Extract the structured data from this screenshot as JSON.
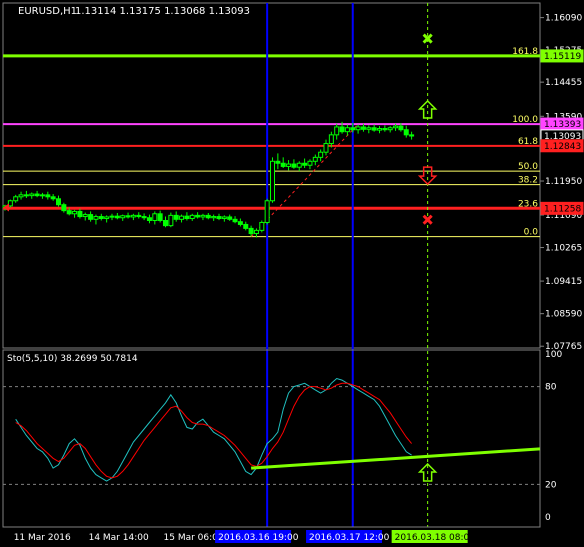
{
  "header": {
    "symbol": "EURUSD,H1",
    "ohlc": "1.13114 1.13175 1.13068 1.13093"
  },
  "colors": {
    "background": "#000000",
    "grid": "#808080",
    "bull_candle": "#00ff00",
    "fib_line": "#ffff66",
    "fib_161": "#7fff00",
    "fib_100": "#ff44ff",
    "support_red": "#ff2020",
    "vertical_blue": "#0000ff",
    "stoch_main": "#20c0c0",
    "stoch_signal": "#ff0000",
    "trendline": "#7fff00",
    "dashed_future": "#7fff00",
    "price_label_current": "#ffffff"
  },
  "chart_data": [
    {
      "type": "candlestick",
      "title": "EURUSD,H1",
      "ylim": [
        1.0772,
        1.1646
      ],
      "y_ticks": [
        "1.16090",
        "1.15275",
        "1.14455",
        "1.13590",
        "1.12765",
        "1.11950",
        "1.11090",
        "1.10265",
        "1.09415",
        "1.08590",
        "1.07765"
      ],
      "price_tags": [
        {
          "label": "1.15119",
          "value": 1.15119,
          "color": "#7fff00",
          "text_color": "#000000"
        },
        {
          "label": "1.13393",
          "value": 1.13393,
          "color": "#ff44ff",
          "text_color": "#000000"
        },
        {
          "label": "1.13093",
          "value": 1.13093,
          "color": "#ffffff",
          "text_color": "#000000",
          "boxed": true
        },
        {
          "label": "1.12843",
          "value": 1.12843,
          "color": "#ff2020",
          "text_color": "#000000"
        },
        {
          "label": "1.11258",
          "value": 1.11258,
          "color": "#ff2020",
          "text_color": "#000000"
        }
      ],
      "fibonacci_levels": [
        {
          "label": "161.8",
          "value": 1.1512
        },
        {
          "label": "100.0",
          "value": 1.1339
        },
        {
          "label": "61.8",
          "value": 1.1284
        },
        {
          "label": "50.0",
          "value": 1.122
        },
        {
          "label": "38.2",
          "value": 1.1186
        },
        {
          "label": "23.6",
          "value": 1.1126
        },
        {
          "label": "0.0",
          "value": 1.1054
        }
      ],
      "horizontal_lines": [
        {
          "value": 1.1512,
          "color": "#7fff00",
          "width": 3
        },
        {
          "value": 1.1339,
          "color": "#ff44ff",
          "width": 2
        },
        {
          "value": 1.1284,
          "color": "#ff2020",
          "width": 2
        },
        {
          "value": 1.1126,
          "color": "#ff2020",
          "width": 3
        }
      ],
      "candles": [
        {
          "t": 0,
          "o": 1.1128,
          "h": 1.1135,
          "l": 1.112,
          "c": 1.1132
        },
        {
          "t": 1,
          "o": 1.1132,
          "h": 1.1148,
          "l": 1.1128,
          "c": 1.1145
        },
        {
          "t": 2,
          "o": 1.1145,
          "h": 1.116,
          "l": 1.114,
          "c": 1.1155
        },
        {
          "t": 3,
          "o": 1.1155,
          "h": 1.1168,
          "l": 1.1148,
          "c": 1.116
        },
        {
          "t": 4,
          "o": 1.116,
          "h": 1.117,
          "l": 1.1152,
          "c": 1.1158
        },
        {
          "t": 5,
          "o": 1.1158,
          "h": 1.1166,
          "l": 1.115,
          "c": 1.1162
        },
        {
          "t": 6,
          "o": 1.1162,
          "h": 1.117,
          "l": 1.1154,
          "c": 1.1158
        },
        {
          "t": 7,
          "o": 1.1158,
          "h": 1.1165,
          "l": 1.115,
          "c": 1.116
        },
        {
          "t": 8,
          "o": 1.116,
          "h": 1.1168,
          "l": 1.1148,
          "c": 1.1155
        },
        {
          "t": 9,
          "o": 1.1155,
          "h": 1.1162,
          "l": 1.1145,
          "c": 1.115
        },
        {
          "t": 10,
          "o": 1.115,
          "h": 1.1158,
          "l": 1.113,
          "c": 1.1135
        },
        {
          "t": 11,
          "o": 1.1135,
          "h": 1.114,
          "l": 1.1115,
          "c": 1.112
        },
        {
          "t": 12,
          "o": 1.112,
          "h": 1.1128,
          "l": 1.1108,
          "c": 1.1112
        },
        {
          "t": 13,
          "o": 1.1112,
          "h": 1.1122,
          "l": 1.1102,
          "c": 1.1118
        },
        {
          "t": 14,
          "o": 1.1118,
          "h": 1.1125,
          "l": 1.11,
          "c": 1.1105
        },
        {
          "t": 15,
          "o": 1.1105,
          "h": 1.1115,
          "l": 1.1095,
          "c": 1.111
        },
        {
          "t": 16,
          "o": 1.111,
          "h": 1.1118,
          "l": 1.1092,
          "c": 1.1098
        },
        {
          "t": 17,
          "o": 1.1098,
          "h": 1.111,
          "l": 1.1085,
          "c": 1.1105
        },
        {
          "t": 18,
          "o": 1.1105,
          "h": 1.1112,
          "l": 1.1095,
          "c": 1.11
        },
        {
          "t": 19,
          "o": 1.11,
          "h": 1.1108,
          "l": 1.109,
          "c": 1.1104
        },
        {
          "t": 20,
          "o": 1.1104,
          "h": 1.1112,
          "l": 1.1096,
          "c": 1.1106
        },
        {
          "t": 21,
          "o": 1.1106,
          "h": 1.1114,
          "l": 1.1098,
          "c": 1.1102
        },
        {
          "t": 22,
          "o": 1.1102,
          "h": 1.111,
          "l": 1.1094,
          "c": 1.1107
        },
        {
          "t": 23,
          "o": 1.1107,
          "h": 1.1115,
          "l": 1.11,
          "c": 1.1104
        },
        {
          "t": 24,
          "o": 1.1104,
          "h": 1.1112,
          "l": 1.1096,
          "c": 1.1108
        },
        {
          "t": 25,
          "o": 1.1108,
          "h": 1.1116,
          "l": 1.11,
          "c": 1.1105
        },
        {
          "t": 26,
          "o": 1.1105,
          "h": 1.1113,
          "l": 1.1096,
          "c": 1.1102
        },
        {
          "t": 27,
          "o": 1.1102,
          "h": 1.111,
          "l": 1.1088,
          "c": 1.1095
        },
        {
          "t": 28,
          "o": 1.1095,
          "h": 1.1118,
          "l": 1.1085,
          "c": 1.1112
        },
        {
          "t": 29,
          "o": 1.1112,
          "h": 1.112,
          "l": 1.109,
          "c": 1.1095
        },
        {
          "t": 30,
          "o": 1.1095,
          "h": 1.1105,
          "l": 1.1078,
          "c": 1.1082
        },
        {
          "t": 31,
          "o": 1.1082,
          "h": 1.1115,
          "l": 1.1078,
          "c": 1.1108
        },
        {
          "t": 32,
          "o": 1.1108,
          "h": 1.1118,
          "l": 1.1092,
          "c": 1.1098
        },
        {
          "t": 33,
          "o": 1.1098,
          "h": 1.111,
          "l": 1.109,
          "c": 1.1106
        },
        {
          "t": 34,
          "o": 1.1106,
          "h": 1.1116,
          "l": 1.1095,
          "c": 1.11
        },
        {
          "t": 35,
          "o": 1.11,
          "h": 1.1112,
          "l": 1.1094,
          "c": 1.1108
        },
        {
          "t": 36,
          "o": 1.1108,
          "h": 1.1116,
          "l": 1.11,
          "c": 1.1104
        },
        {
          "t": 37,
          "o": 1.1104,
          "h": 1.1112,
          "l": 1.1096,
          "c": 1.1108
        },
        {
          "t": 38,
          "o": 1.1108,
          "h": 1.1114,
          "l": 1.1098,
          "c": 1.1102
        },
        {
          "t": 39,
          "o": 1.1102,
          "h": 1.111,
          "l": 1.1094,
          "c": 1.1105
        },
        {
          "t": 40,
          "o": 1.1105,
          "h": 1.1112,
          "l": 1.1096,
          "c": 1.11
        },
        {
          "t": 41,
          "o": 1.11,
          "h": 1.1108,
          "l": 1.1092,
          "c": 1.1104
        },
        {
          "t": 42,
          "o": 1.1104,
          "h": 1.111,
          "l": 1.1094,
          "c": 1.1098
        },
        {
          "t": 43,
          "o": 1.1098,
          "h": 1.1106,
          "l": 1.1088,
          "c": 1.1092
        },
        {
          "t": 44,
          "o": 1.1092,
          "h": 1.11,
          "l": 1.108,
          "c": 1.1085
        },
        {
          "t": 45,
          "o": 1.1085,
          "h": 1.1092,
          "l": 1.107,
          "c": 1.1075
        },
        {
          "t": 46,
          "o": 1.1075,
          "h": 1.1082,
          "l": 1.1055,
          "c": 1.1062
        },
        {
          "t": 47,
          "o": 1.1062,
          "h": 1.1075,
          "l": 1.1052,
          "c": 1.107
        },
        {
          "t": 48,
          "o": 1.107,
          "h": 1.1095,
          "l": 1.1065,
          "c": 1.109
        },
        {
          "t": 49,
          "o": 1.109,
          "h": 1.115,
          "l": 1.1085,
          "c": 1.1145
        },
        {
          "t": 50,
          "o": 1.1145,
          "h": 1.1255,
          "l": 1.114,
          "c": 1.1245
        },
        {
          "t": 51,
          "o": 1.1245,
          "h": 1.1265,
          "l": 1.1225,
          "c": 1.124
        },
        {
          "t": 52,
          "o": 1.124,
          "h": 1.1255,
          "l": 1.1228,
          "c": 1.1232
        },
        {
          "t": 53,
          "o": 1.1232,
          "h": 1.1248,
          "l": 1.1222,
          "c": 1.1238
        },
        {
          "t": 54,
          "o": 1.1238,
          "h": 1.125,
          "l": 1.1226,
          "c": 1.123
        },
        {
          "t": 55,
          "o": 1.123,
          "h": 1.1245,
          "l": 1.122,
          "c": 1.124
        },
        {
          "t": 56,
          "o": 1.124,
          "h": 1.1252,
          "l": 1.1228,
          "c": 1.1235
        },
        {
          "t": 57,
          "o": 1.1235,
          "h": 1.125,
          "l": 1.1225,
          "c": 1.1245
        },
        {
          "t": 58,
          "o": 1.1245,
          "h": 1.1262,
          "l": 1.1235,
          "c": 1.1255
        },
        {
          "t": 59,
          "o": 1.1255,
          "h": 1.1275,
          "l": 1.1245,
          "c": 1.1268
        },
        {
          "t": 60,
          "o": 1.1268,
          "h": 1.13,
          "l": 1.126,
          "c": 1.129
        },
        {
          "t": 61,
          "o": 1.129,
          "h": 1.132,
          "l": 1.128,
          "c": 1.1312
        },
        {
          "t": 62,
          "o": 1.1312,
          "h": 1.134,
          "l": 1.13,
          "c": 1.1332
        },
        {
          "t": 63,
          "o": 1.1332,
          "h": 1.1345,
          "l": 1.1315,
          "c": 1.132
        },
        {
          "t": 64,
          "o": 1.132,
          "h": 1.1338,
          "l": 1.131,
          "c": 1.133
        },
        {
          "t": 65,
          "o": 1.133,
          "h": 1.1342,
          "l": 1.1318,
          "c": 1.1325
        },
        {
          "t": 66,
          "o": 1.1325,
          "h": 1.1338,
          "l": 1.1315,
          "c": 1.1332
        },
        {
          "t": 67,
          "o": 1.1332,
          "h": 1.134,
          "l": 1.132,
          "c": 1.1326
        },
        {
          "t": 68,
          "o": 1.1326,
          "h": 1.1336,
          "l": 1.1316,
          "c": 1.133
        },
        {
          "t": 69,
          "o": 1.133,
          "h": 1.1338,
          "l": 1.132,
          "c": 1.1324
        },
        {
          "t": 70,
          "o": 1.1324,
          "h": 1.1334,
          "l": 1.1316,
          "c": 1.1328
        },
        {
          "t": 71,
          "o": 1.1328,
          "h": 1.1336,
          "l": 1.132,
          "c": 1.1325
        },
        {
          "t": 72,
          "o": 1.1325,
          "h": 1.1334,
          "l": 1.1318,
          "c": 1.133
        },
        {
          "t": 73,
          "o": 1.133,
          "h": 1.134,
          "l": 1.1322,
          "c": 1.1334
        },
        {
          "t": 74,
          "o": 1.1334,
          "h": 1.1342,
          "l": 1.132,
          "c": 1.1325
        },
        {
          "t": 75,
          "o": 1.1325,
          "h": 1.1335,
          "l": 1.1305,
          "c": 1.1312
        },
        {
          "t": 76,
          "o": 1.1312,
          "h": 1.132,
          "l": 1.13,
          "c": 1.1309
        }
      ],
      "vertical_lines_t": [
        49,
        65
      ],
      "current_t": 79,
      "markers": [
        {
          "type": "x",
          "t": 79,
          "value": 1.1556,
          "color": "#7fff00"
        },
        {
          "type": "arrow-up",
          "t": 79,
          "value": 1.1375,
          "color": "#7fff00"
        },
        {
          "type": "arrow-down",
          "t": 79,
          "value": 1.121,
          "color": "#ff2020"
        },
        {
          "type": "x",
          "t": 79,
          "value": 1.1097,
          "color": "#ff2020"
        }
      ]
    },
    {
      "type": "line",
      "title": "Sto(5,5,10) 38.2699 50.7814",
      "ylim": [
        0,
        100
      ],
      "y_ticks": [
        "100",
        "80",
        "20",
        "0"
      ],
      "levels": [
        80,
        20
      ],
      "series": [
        {
          "name": "main",
          "color": "#20c0c0",
          "values": [
            60,
            55,
            50,
            46,
            42,
            40,
            36,
            30,
            32,
            38,
            45,
            48,
            44,
            36,
            30,
            26,
            24,
            22,
            24,
            28,
            34,
            40,
            46,
            50,
            54,
            58,
            62,
            66,
            70,
            75,
            70,
            62,
            55,
            54,
            58,
            60,
            56,
            52,
            50,
            48,
            44,
            40,
            34,
            28,
            26,
            30,
            38,
            45,
            48,
            52,
            66,
            76,
            80,
            81,
            82,
            80,
            78,
            76,
            78,
            82,
            85,
            84,
            82,
            80,
            78,
            76,
            74,
            72,
            68,
            62,
            56,
            50,
            45,
            40,
            38
          ]
        },
        {
          "name": "signal",
          "color": "#ff0000",
          "values": [
            58,
            56,
            53,
            49,
            45,
            42,
            39,
            36,
            34,
            36,
            40,
            44,
            45,
            42,
            37,
            32,
            28,
            25,
            24,
            25,
            28,
            32,
            37,
            42,
            47,
            51,
            55,
            59,
            63,
            67,
            68,
            65,
            61,
            58,
            57,
            57,
            56,
            54,
            52,
            50,
            47,
            44,
            40,
            36,
            32,
            31,
            33,
            37,
            42,
            46,
            52,
            60,
            68,
            74,
            78,
            80,
            80,
            79,
            78,
            79,
            81,
            82,
            82,
            81,
            80,
            78,
            76,
            74,
            72,
            68,
            64,
            59,
            54,
            49,
            45
          ]
        }
      ],
      "trendline": {
        "t1": 46,
        "v1": 30,
        "t2": 110,
        "v2": 44,
        "color": "#7fff00"
      },
      "marker": {
        "type": "arrow-up",
        "t": 79,
        "value": 27,
        "color": "#7fff00"
      }
    }
  ],
  "time_axis": {
    "labels": [
      {
        "t": 2,
        "text": "11 Mar 2016"
      },
      {
        "t": 16,
        "text": "14 Mar 14:00"
      },
      {
        "t": 30,
        "text": "15 Mar 06:00"
      },
      {
        "t": 44,
        "text": "15 Mar"
      }
    ],
    "highlight_labels": [
      {
        "t": 46,
        "text": "2016.03.16 19:00",
        "color": "#0000ff"
      },
      {
        "t": 63,
        "text": "2016.03.17 12:00",
        "color": "#0000ff"
      },
      {
        "t": 79,
        "text": "2016.03.18 08:00",
        "color": "#7fff00"
      }
    ]
  }
}
